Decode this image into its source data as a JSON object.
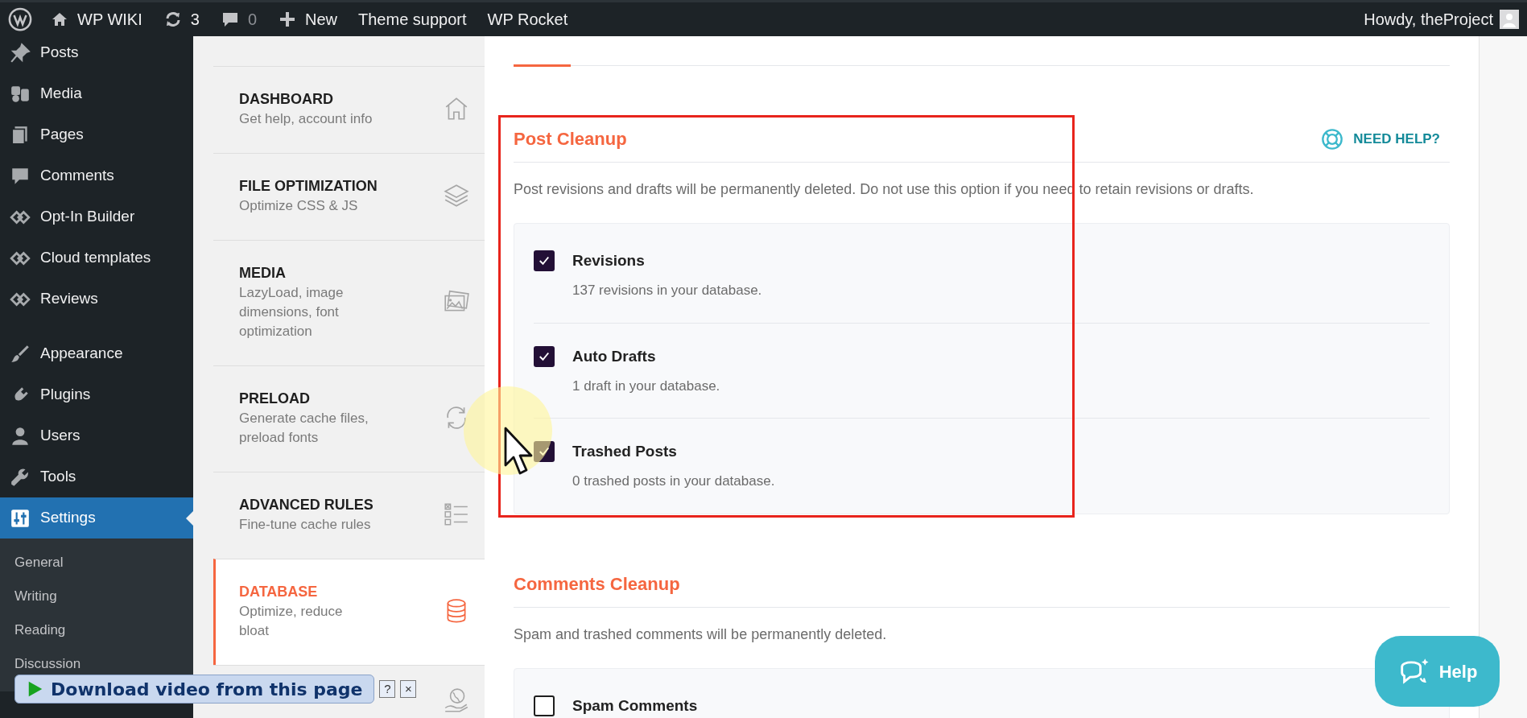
{
  "admin_bar": {
    "items": [
      {
        "kind": "logo"
      },
      {
        "kind": "home",
        "label": "WP WIKI"
      },
      {
        "kind": "updates",
        "label": "3"
      },
      {
        "kind": "comments",
        "label": "0"
      },
      {
        "kind": "new",
        "label": "New"
      },
      {
        "kind": "link",
        "label": "Theme support"
      },
      {
        "kind": "link",
        "label": "WP Rocket"
      }
    ],
    "account": "Howdy, theProject"
  },
  "sidebar": {
    "items": [
      {
        "label": "Posts",
        "selected": false
      },
      {
        "label": "Media",
        "selected": false
      },
      {
        "label": "Pages",
        "selected": false
      },
      {
        "label": "Comments",
        "selected": false
      },
      {
        "label": "Opt-In Builder",
        "selected": false
      },
      {
        "label": "Cloud templates",
        "selected": false
      },
      {
        "label": "Reviews",
        "selected": false
      },
      {
        "label": "Appearance",
        "selected": false
      },
      {
        "label": "Plugins",
        "selected": false
      },
      {
        "label": "Users",
        "selected": false
      },
      {
        "label": "Tools",
        "selected": false
      },
      {
        "label": "Settings",
        "selected": true
      }
    ],
    "submenu": [
      "General",
      "Writing",
      "Reading",
      "Discussion"
    ]
  },
  "rocket_nav": {
    "items": [
      {
        "title": "DASHBOARD",
        "description": "Get help, account info",
        "selected": false
      },
      {
        "title": "FILE OPTIMIZATION",
        "description": "Optimize CSS & JS",
        "selected": false
      },
      {
        "title": "MEDIA",
        "description": "LazyLoad, image dimensions, font optimization",
        "selected": false
      },
      {
        "title": "PRELOAD",
        "description": "Generate cache files, preload fonts",
        "selected": false
      },
      {
        "title": "ADVANCED RULES",
        "description": "Fine-tune cache rules",
        "selected": false
      },
      {
        "title": "DATABASE",
        "description": "Optimize, reduce bloat",
        "selected": true
      }
    ]
  },
  "sections": [
    {
      "title": "Post Cleanup",
      "help_link": "NEED HELP?",
      "description": "Post revisions and drafts will be permanently deleted. Do not use this option if you need to retain revisions or drafts.",
      "options": [
        {
          "label": "Revisions",
          "detail": "137 revisions in your database.",
          "checked": true
        },
        {
          "label": "Auto Drafts",
          "detail": "1 draft in your database.",
          "checked": true
        },
        {
          "label": "Trashed Posts",
          "detail": "0 trashed posts in your database.",
          "checked": true
        }
      ]
    },
    {
      "title": "Comments Cleanup",
      "description": "Spam and trashed comments will be permanently deleted.",
      "options": [
        {
          "label": "Spam Comments",
          "checked": false
        }
      ]
    }
  ],
  "help_button": {
    "label": "Help"
  },
  "download_bar": {
    "label": "Download video from this page",
    "help": "?",
    "close": "×"
  }
}
